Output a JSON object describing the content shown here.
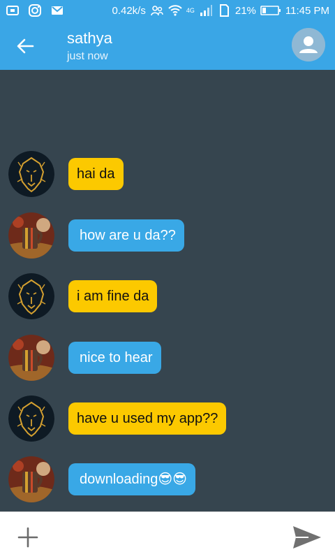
{
  "status_bar": {
    "speed": "0.42k/s",
    "network": "4G",
    "battery": "21%",
    "time": "11:45 PM",
    "icons": [
      "screenshot-icon",
      "instagram-icon",
      "gmail-icon",
      "contacts-icon",
      "wifi-icon",
      "signal-icon",
      "sim-icon",
      "battery-icon"
    ]
  },
  "header": {
    "contact_name": "sathya",
    "last_seen": "just now"
  },
  "messages": [
    {
      "sender": "lion",
      "text": "hai da",
      "color": "#fcc900"
    },
    {
      "sender": "mug",
      "text": "how are u da??",
      "color": "#39a8e6"
    },
    {
      "sender": "lion",
      "text": "i am fine da",
      "color": "#fcc900"
    },
    {
      "sender": "mug",
      "text": "nice to hear",
      "color": "#39a8e6"
    },
    {
      "sender": "lion",
      "text": "have u used my app??",
      "color": "#fcc900"
    },
    {
      "sender": "mug",
      "text": "downloading😎😎",
      "color": "#39a8e6"
    }
  ],
  "input": {
    "placeholder": ""
  },
  "colors": {
    "primary": "#3aa6e6",
    "chat_background": "#36454f",
    "yellow_bubble": "#fcc900",
    "blue_bubble": "#39a8e6"
  }
}
